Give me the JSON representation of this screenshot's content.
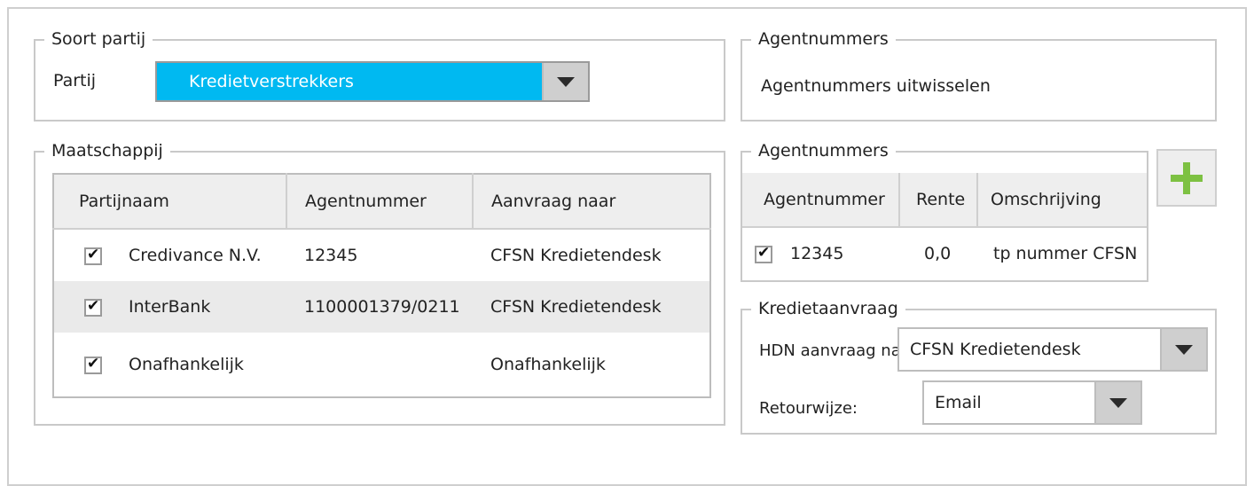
{
  "soort_partij": {
    "legend": "Soort partij",
    "partij_label": "Partij",
    "partij_value": "Kredietverstrekkers"
  },
  "agentnummers_top": {
    "legend": "Agentnummers",
    "text": "Agentnummers uitwisselen"
  },
  "maatschappij": {
    "legend": "Maatschappij",
    "headers": [
      "Partijnaam",
      "Agentnummer",
      "Aanvraag naar"
    ],
    "rows": [
      {
        "name": "Credivance N.V.",
        "agent": "12345",
        "aanvraag": "CFSN Kredietendesk"
      },
      {
        "name": "InterBank",
        "agent": "1100001379/0211",
        "aanvraag": "CFSN Kredietendesk"
      },
      {
        "name": "Onafhankelijk",
        "agent": "",
        "aanvraag": "Onafhankelijk"
      }
    ]
  },
  "agentnummers_table": {
    "legend": "Agentnummers",
    "headers": [
      "Agentnummer",
      "Rente",
      "Omschrijving"
    ],
    "rows": [
      {
        "agent": "12345",
        "rente": "0,0",
        "omschrijving": "tp nummer CFSN"
      }
    ],
    "add_icon": "plus-icon",
    "add_color": "#7dc142"
  },
  "kredietaanvraag": {
    "legend": "Kredietaanvraag",
    "hdn_label": "HDN aanvraag naar:",
    "hdn_value": "CFSN Kredietendesk",
    "retour_label": "Retourwijze:",
    "retour_value": "Email"
  },
  "colors": {
    "selected_bg": "#00b9f1",
    "row_highlight": "#eaeaea"
  }
}
